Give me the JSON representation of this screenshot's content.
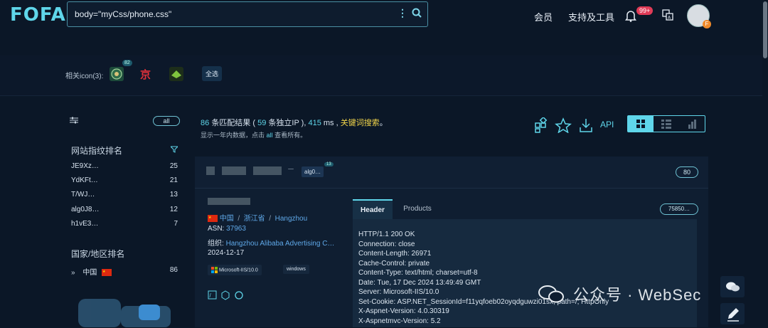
{
  "header": {
    "logo": "FOFA",
    "search_value": "body=\"myCss/phone.css\"",
    "nav": [
      "会员",
      "支持及工具"
    ],
    "notification_badge": "99+",
    "avatar_badge": "F"
  },
  "icon_filter": {
    "label": "相关icon(3):",
    "first_icon_count": "82",
    "select_all": "全选"
  },
  "sidebar": {
    "all_label": "all",
    "fingerprint_title": "网站指纹排名",
    "fingerprints": [
      {
        "name": "JE9Xz…",
        "count": "25"
      },
      {
        "name": "YdKFt…",
        "count": "21"
      },
      {
        "name": "T/WJ…",
        "count": "13"
      },
      {
        "name": "alg0J8…",
        "count": "12"
      },
      {
        "name": "h1vE3…",
        "count": "7"
      }
    ],
    "country_title": "国家/地区排名",
    "countries": [
      {
        "name": "中国",
        "count": "86"
      }
    ]
  },
  "summary": {
    "count": "86",
    "t1": "条匹配结果 (",
    "ips": "59",
    "t2": "条独立IP ),",
    "ms": "415",
    "t3": "ms ,",
    "keyword": "关键词搜索",
    "t4": "。",
    "sub_prefix": "显示一年内数据，点击",
    "sub_all": "all",
    "sub_suffix": "查看所有。",
    "api": "API"
  },
  "result": {
    "alg_tag": "alg0…",
    "alg_count": "13",
    "port": "80",
    "country": "中国",
    "province": "浙江省",
    "city": "Hangzhou",
    "asn_label": "ASN:",
    "asn": "37963",
    "org_label": "组织:",
    "org": "Hangzhou Alibaba Advertising C…",
    "date": "2024-12-17",
    "tags": [
      "Microsoft-IIS/10.0",
      "windows"
    ],
    "tabs": [
      "Header",
      "Products"
    ],
    "hash": "75850…",
    "header_lines": [
      "HTTP/1.1 200 OK",
      "Connection: close",
      "Content-Length: 26971",
      "Cache-Control: private",
      "Content-Type: text/html; charset=utf-8",
      "Date: Tue, 17 Dec 2024 13:49:49 GMT",
      "Server: Microsoft-IIS/10.0",
      "Set-Cookie: ASP.NET_SessionId=f11yqfoeb02oyqdguwzi01sx; path=/; HttpOnly",
      "X-Aspnet-Version: 4.0.30319",
      "X-Aspnetmvc-Version: 5.2"
    ]
  },
  "watermark": "公众号 · WebSec",
  "colors": {
    "accent": "#5fd6ea",
    "keyword": "#f3d64b",
    "link": "#5fa8e8",
    "background": "#0b1727"
  }
}
